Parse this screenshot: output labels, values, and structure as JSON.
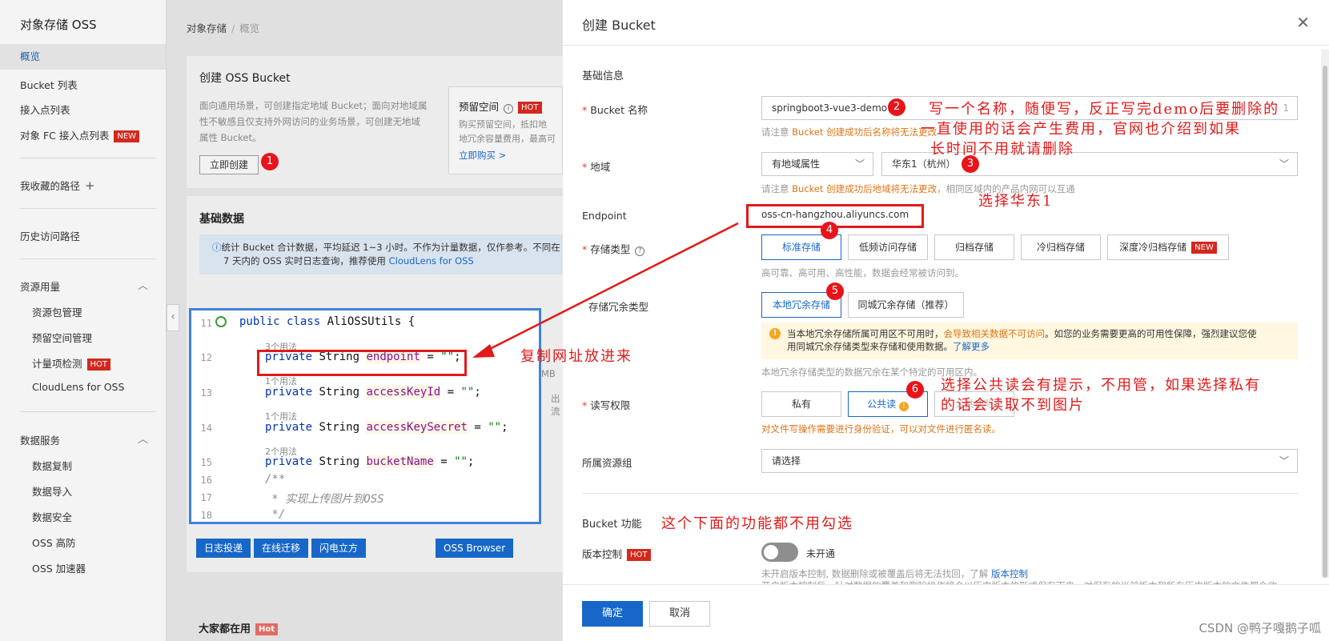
{
  "sidebar": {
    "title": "对象存储 OSS",
    "items": [
      {
        "label": "概览"
      },
      {
        "label": "Bucket 列表"
      },
      {
        "label": "接入点列表"
      },
      {
        "label": "对象 FC 接入点列表",
        "tag": "NEW"
      },
      {
        "label": "我收藏的路径"
      },
      {
        "label": "历史访问路径"
      },
      {
        "label": "资源用量"
      },
      {
        "label": "资源包管理"
      },
      {
        "label": "预留空间管理"
      },
      {
        "label": "计量项检测",
        "tag": "HOT"
      },
      {
        "label": "CloudLens for OSS"
      },
      {
        "label": "数据服务"
      },
      {
        "label": "数据复制"
      },
      {
        "label": "数据导入"
      },
      {
        "label": "数据安全"
      },
      {
        "label": "OSS 高防"
      },
      {
        "label": "OSS 加速器"
      }
    ]
  },
  "main": {
    "breadcrumb": [
      "对象存储",
      "概览"
    ],
    "create_card": {
      "title": "创建 OSS Bucket",
      "desc": [
        "面向通用场景，可创建指定地域 Bucket；面向对地域属",
        "性不敏感且仅支持外网访问的业务场景，可创建无地域",
        "属性 Bucket。"
      ],
      "button": "立即创建"
    },
    "reserve_card": {
      "title": "预留空间",
      "tag": "HOT",
      "desc": [
        "购买预留空间，抵扣地",
        "地冗余容量费用，最高可"
      ],
      "link": "立即购买 >"
    },
    "basic_data": {
      "title": "基础数据",
      "info": [
        "统计 Bucket 合计数据，平均延迟 1~3 小时。不作为计量数据，仅作参考。不同在",
        "7 天内的 OSS 实时日志查询，推荐使用"
      ],
      "info_link": "CloudLens for OSS",
      "unit": "MB",
      "frag": "出流"
    },
    "tools": [
      "日志投递",
      "在线迁移",
      "闪电立方",
      "OSS Browser"
    ],
    "popular": {
      "title": "大家都在用",
      "tag": "Hot"
    }
  },
  "code": {
    "lines": [
      {
        "no": "11",
        "text": "public class AliOSSUtils {"
      },
      {
        "hint": "3个用法"
      },
      {
        "no": "12",
        "field": "endpoint"
      },
      {
        "hint": "1个用法"
      },
      {
        "no": "13",
        "field": "accessKeyId"
      },
      {
        "hint": "1个用法"
      },
      {
        "no": "14",
        "field": "accessKeySecret"
      },
      {
        "hint": "2个用法"
      },
      {
        "no": "15",
        "field": "bucketName"
      },
      {
        "no": "16",
        "text": "/**"
      },
      {
        "no": "17",
        "text": " * 实现上传图片到OSS"
      },
      {
        "no": "18",
        "text": " */"
      }
    ],
    "kw_private": "private",
    "kw_type": "String",
    "assign": " = ",
    "str_empty": "\"\"",
    "semicolon": ";"
  },
  "drawer": {
    "title": "创建 Bucket",
    "section_basic": "基础信息",
    "bucket_name": {
      "label": "Bucket 名称",
      "value": "springboot3-vue3-demo",
      "counter": "1",
      "note_prefix": "请注意",
      "note_warn": "Bucket 创建成功后名称将无法更改"
    },
    "region": {
      "label": "地域",
      "attr_value": "有地域属性",
      "value": "华东1（杭州）",
      "note_prefix": "请注意",
      "note_warn": "Bucket 创建成功后地域将无法更改",
      "note_suffix": "，相同区域内的产品内网可以互通"
    },
    "endpoint": {
      "label": "Endpoint",
      "value": "oss-cn-hangzhou.aliyuncs.com"
    },
    "storage_class": {
      "label": "存储类型",
      "options": [
        "标准存储",
        "低频访问存储",
        "归档存储",
        "冷归档存储",
        "深度冷归档存储"
      ],
      "new_tag": "NEW",
      "note": "高可靠、高可用、高性能，数据会经常被访问到。"
    },
    "redundancy": {
      "label": "存储冗余类型",
      "options": [
        "本地冗余存储",
        "同城冗余存储（推荐）"
      ]
    },
    "alert": {
      "part1": "当本地冗余存储所属可用区不可用时，",
      "orange": "会导致相关数据不可访问",
      "part2": "。如您的业务需要更高的可用性保障，强烈建议您使",
      "line2": "用同城冗余存储类型来存储和使用数据。",
      "link": "了解更多"
    },
    "redundancy_note": "本地冗余存储类型的数据冗余在某个特定的可用区内。",
    "acl": {
      "label": "读写权限",
      "options": [
        "私有",
        "公共读",
        "公共读写"
      ],
      "warn": "对文件写操作需要进行身份验证，可以对文件进行匿名读。"
    },
    "resource_group": {
      "label": "所属资源组",
      "placeholder": "请选择"
    },
    "section_feature": "Bucket 功能",
    "versioning": {
      "label": "版本控制",
      "tag": "HOT",
      "state": "未开通",
      "note": "未开启版本控制, 数据删除或被覆盖后将无法找回，了解",
      "note_link": "版本控制",
      "note2": "开启版本控制后，针对数据的覆盖和删除操作将会以历史版本的形式保存下来，对保存的当前版本和所有历史版本的文件都会收"
    },
    "confirm": "确定",
    "cancel": "取消"
  },
  "annotations": {
    "a1": "写一个名称，随便写，反正写完demo后要删除的",
    "a1b": "一直使用的话会产生费用，官网也介绍到如果",
    "a1c": "长时间不用就请删除",
    "a3": "选择华东1",
    "a4": "复制网址放进来",
    "a6": "选择公共读会有提示，不用管，如果选择私有",
    "a6b": "的话会读取不到图片",
    "a7": "这个下面的功能都不用勾选",
    "badges": [
      "1",
      "2",
      "3",
      "4",
      "5",
      "6"
    ]
  },
  "watermark": "CSDN @鸭子嘎鹅子呱"
}
